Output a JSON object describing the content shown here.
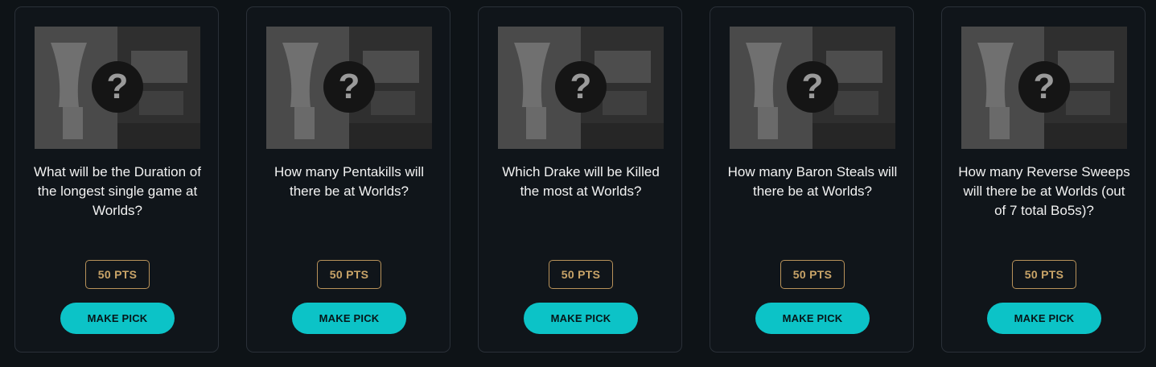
{
  "cards": [
    {
      "question": "What will be the Duration of the longest single game at Worlds?",
      "points": "50 PTS",
      "button": "MAKE PICK",
      "badge": "?"
    },
    {
      "question": "How many Pentakills will there be at Worlds?",
      "points": "50 PTS",
      "button": "MAKE PICK",
      "badge": "?"
    },
    {
      "question": "Which Drake will be Killed the most at Worlds?",
      "points": "50 PTS",
      "button": "MAKE PICK",
      "badge": "?"
    },
    {
      "question": "How many Baron Steals will there be at Worlds?",
      "points": "50 PTS",
      "button": "MAKE PICK",
      "badge": "?"
    },
    {
      "question": "How many Reverse Sweeps will there be at Worlds (out of 7 total Bo5s)?",
      "points": "50 PTS",
      "button": "MAKE PICK",
      "badge": "?"
    }
  ],
  "colors": {
    "background": "#0e1317",
    "card_border": "#2a3038",
    "points_gold": "#c9a468",
    "button_teal": "#0cc3c7"
  },
  "icons": {
    "badge": "question-mark-icon",
    "thumbnail": "trophy-and-arena-image"
  }
}
